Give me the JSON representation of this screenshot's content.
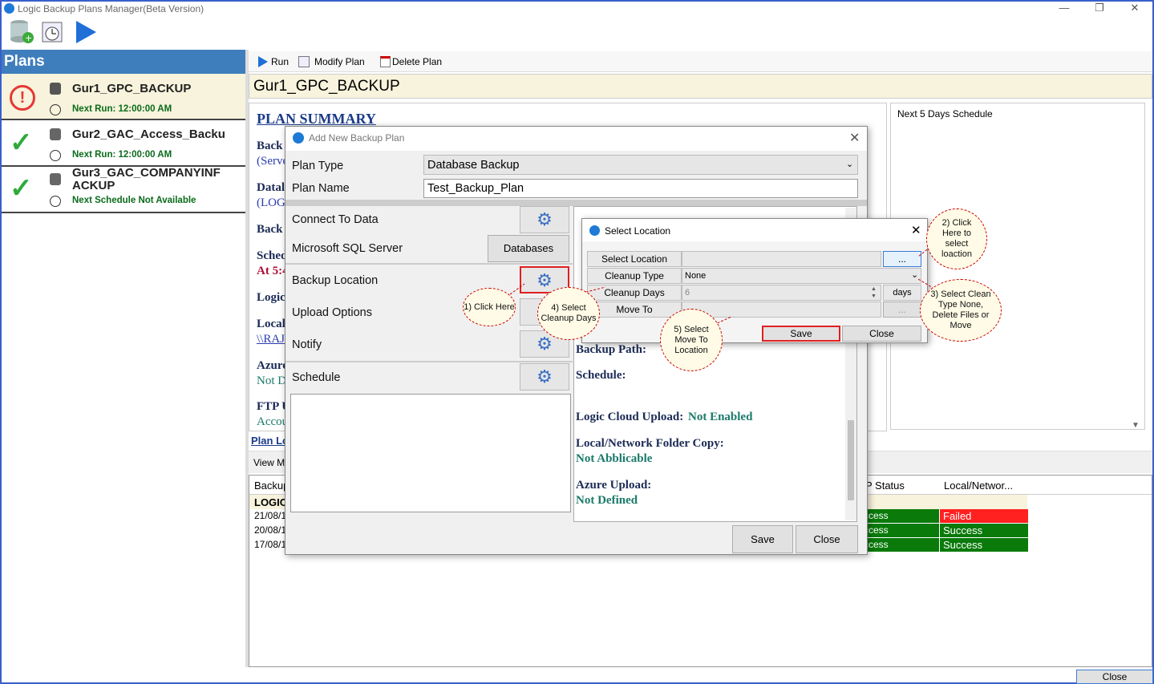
{
  "window": {
    "title": "Logic Backup Plans Manager(Beta Version)"
  },
  "sidebar": {
    "header": "Plans",
    "plans": [
      {
        "name": "Gur1_GPC_BACKUP",
        "next": "Next Run: 12:00:00 AM"
      },
      {
        "name": "Gur2_GAC_Access_Backu",
        "next": "Next Run: 12:00:00 AM"
      },
      {
        "name": "Gur3_GAC_COMPANYINF",
        "name2": "ACKUP",
        "next": "Next Schedule Not Available"
      }
    ]
  },
  "main_toolbar": {
    "run": "Run",
    "modify": "Modify Plan",
    "delete": "Delete Plan"
  },
  "plan_title": "Gur1_GPC_BACKUP",
  "summary": {
    "heading": "PLAN SUMMARY",
    "frag": [
      "Back",
      "(Serve",
      "Datal",
      "(LOG",
      "Back",
      "Sched",
      "At 5:4",
      "Logic",
      "Local",
      "\\\\RAJ",
      "Azure",
      "Not D",
      "FTP U",
      "Accou"
    ]
  },
  "plan_link": "Plan Lo",
  "view_mode": "View Mo",
  "next5": "Next 5 Days Schedule",
  "grid": {
    "headers": [
      "Backup",
      "P Status",
      "Local/Networ..."
    ],
    "group": "LOGIC",
    "rows": [
      {
        "date": "21/08/1",
        "status": "ccess",
        "local": "Failed"
      },
      {
        "date": "20/08/1",
        "status": "ccess",
        "local": "Success"
      },
      {
        "date": "17/08/1",
        "status": "ccess",
        "local": "Success"
      }
    ]
  },
  "add_dialog": {
    "title": "Add New Backup Plan",
    "plan_type_label": "Plan Type",
    "plan_type_value": "Database Backup",
    "plan_name_label": "Plan Name",
    "plan_name_value": "Test_Backup_Plan",
    "connect": "Connect To Data",
    "sql": "Microsoft SQL Server",
    "databases": "Databases",
    "backup_location": "Backup Location",
    "upload": "Upload Options",
    "notify": "Notify",
    "schedule": "Schedule",
    "save": "Save",
    "close": "Close",
    "preview": {
      "backup_path": "Backup Path:",
      "schedule": "Schedule:",
      "cloud_label": "Logic Cloud Upload:",
      "cloud_val": "Not Enabled",
      "local_label": "Local/Network Folder Copy:",
      "local_val": "Not Abblicable",
      "azure_label": "Azure Upload:",
      "azure_val": "Not Defined"
    }
  },
  "select_dialog": {
    "title": "Select Location",
    "select_location": "Select Location",
    "browse": "...",
    "cleanup_type": "Cleanup Type",
    "cleanup_value": "None",
    "cleanup_days": "Cleanup Days",
    "days_value": "6",
    "days": "days",
    "move_to": "Move To",
    "browse2": "...",
    "save": "Save",
    "close": "Close"
  },
  "callouts": {
    "c1": "1) Click Here",
    "c2": "2) Click Here to select loaction",
    "c3": "3) Select Clean Type None, Delete Files or Move",
    "c4": "4) Select Cleanup Days",
    "c5": "5) Select Move To Location"
  },
  "footer": {
    "close": "Close"
  },
  "colors": {
    "plans_header": "#3f7ebd",
    "failed": "#ff2020",
    "success": "#0a7a0a",
    "highlight": "#f7f3dc"
  }
}
